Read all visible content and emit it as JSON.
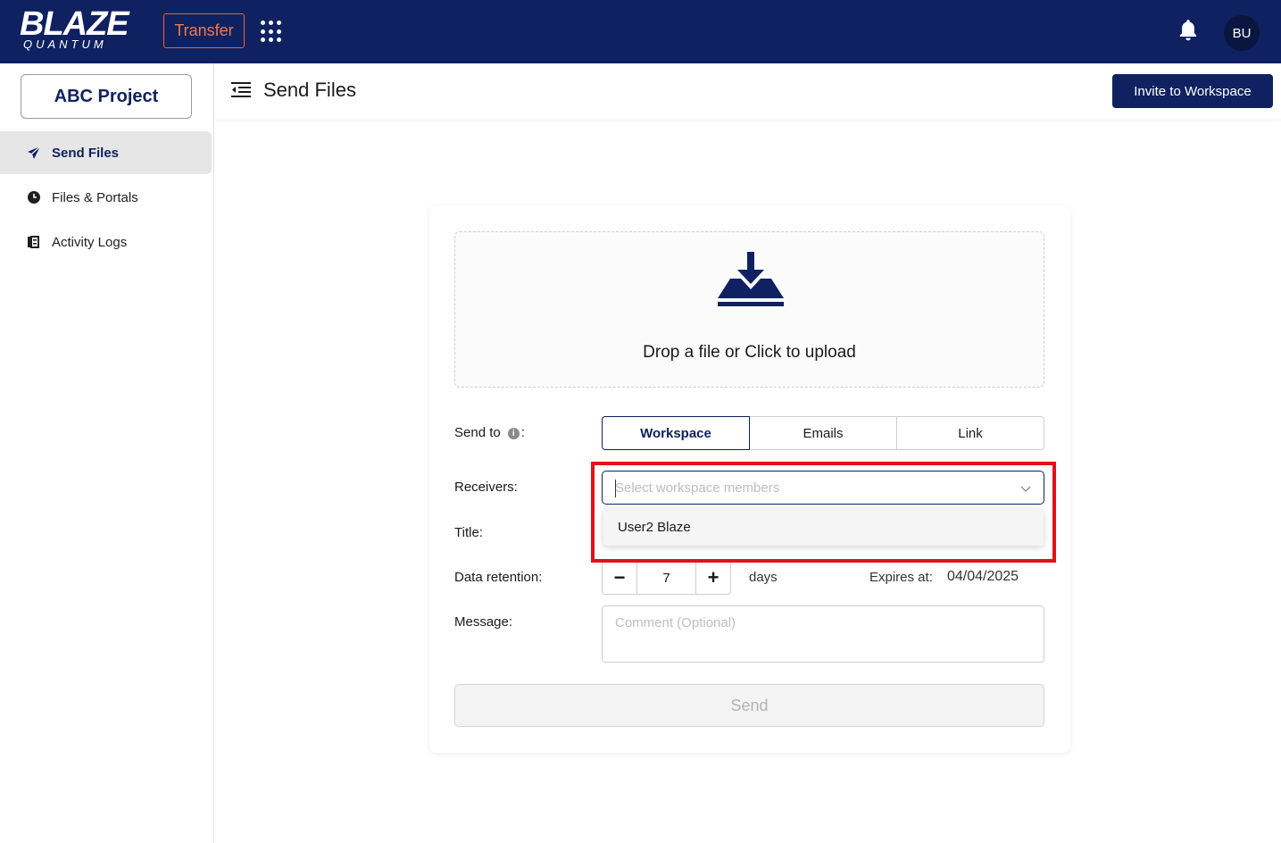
{
  "topbar": {
    "logo_main": "BLAZE",
    "logo_sub": "QUANTUM",
    "transfer_label": "Transfer",
    "avatar_initials": "BU",
    "icons": [
      "apps-grid-icon",
      "bell-icon"
    ]
  },
  "sidebar": {
    "project_label": "ABC Project",
    "items": [
      {
        "label": "Send Files",
        "icon": "send-icon",
        "active": true
      },
      {
        "label": "Files & Portals",
        "icon": "clock-icon",
        "active": false
      },
      {
        "label": "Activity Logs",
        "icon": "log-icon",
        "active": false
      }
    ]
  },
  "header": {
    "title": "Send Files",
    "invite_label": "Invite to Workspace"
  },
  "form": {
    "drop_text": "Drop a file or Click to upload",
    "send_to_label": "Send to",
    "send_to_colon": ":",
    "send_to_options": [
      "Workspace",
      "Emails",
      "Link"
    ],
    "send_to_selected": "Workspace",
    "receivers_label": "Receivers:",
    "receivers_placeholder": "Select workspace members",
    "receiver_options": [
      "User2 Blaze"
    ],
    "title_label": "Title:",
    "retention_label": "Data retention:",
    "retention_value": "7",
    "retention_unit": "days",
    "expires_label": "Expires at:",
    "expires_value": "04/04/2025",
    "message_label": "Message:",
    "message_placeholder": "Comment (Optional)",
    "send_label": "Send"
  },
  "colors": {
    "brand_navy": "#0f2160",
    "transfer_orange": "#f07a4c",
    "highlight_red": "#e0121b"
  }
}
